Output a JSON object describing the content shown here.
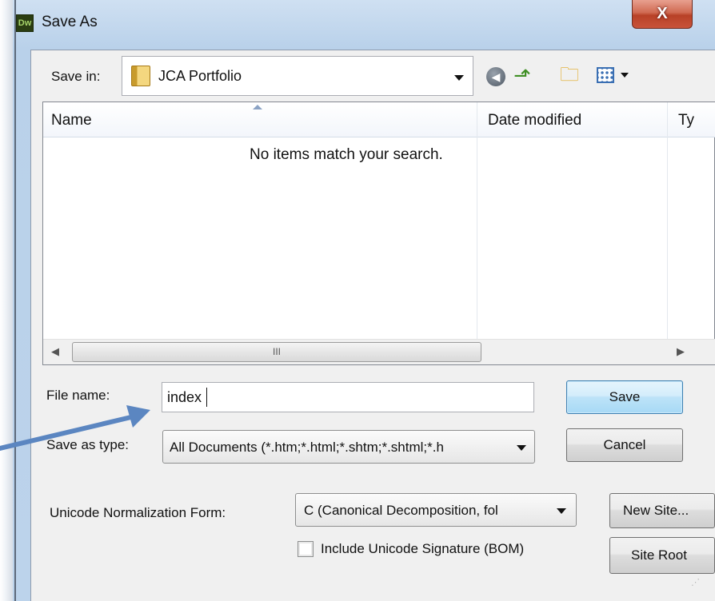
{
  "window": {
    "title": "Save As",
    "app_icon_text": "Dw",
    "close_glyph": "X"
  },
  "save_in": {
    "label": "Save in:",
    "value": "JCA Portfolio"
  },
  "toolbar": {
    "icons": [
      "back-icon",
      "up-one-level-icon",
      "new-folder-icon",
      "views-menu-icon"
    ]
  },
  "file_list": {
    "columns": [
      "Name",
      "Date modified",
      "Ty"
    ],
    "empty_message": "No items match your search.",
    "scrollbar_grip": "III"
  },
  "file_name": {
    "label": "File name:",
    "value": "index"
  },
  "save_as_type": {
    "label": "Save as type:",
    "value": "All Documents (*.htm;*.html;*.shtm;*.shtml;*.h"
  },
  "unicode_form": {
    "label": "Unicode Normalization Form:",
    "value": "C (Canonical Decomposition, fol"
  },
  "bom_checkbox": {
    "label": "Include Unicode Signature (BOM)",
    "checked": false
  },
  "buttons": {
    "save": "Save",
    "cancel": "Cancel",
    "new_site": "New Site...",
    "site_root": "Site Root"
  },
  "annotation": {
    "arrow_color": "#5b86c1"
  }
}
